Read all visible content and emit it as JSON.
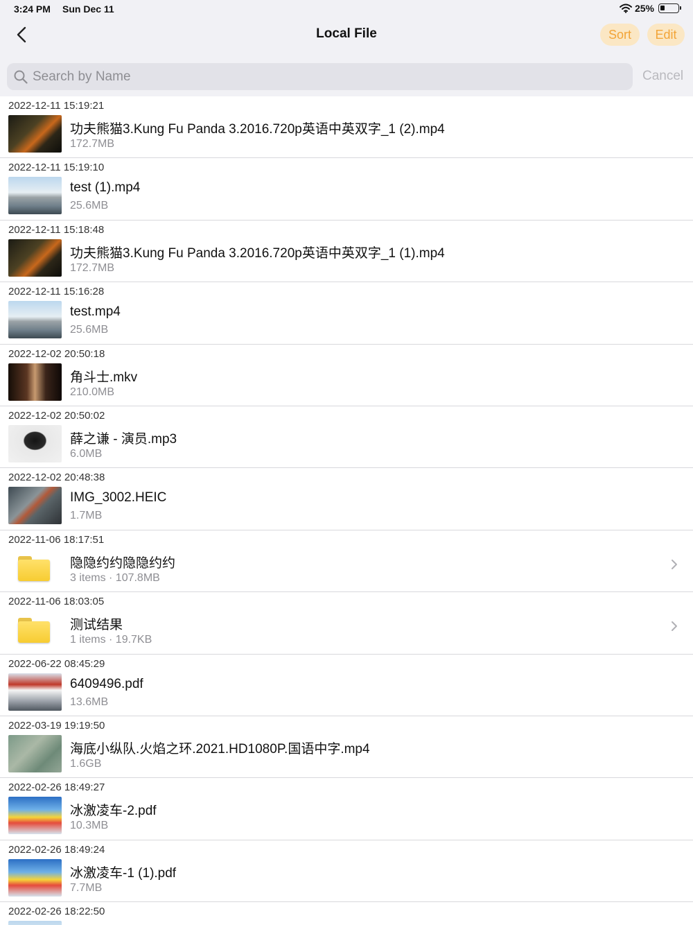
{
  "status": {
    "time": "3:24 PM",
    "date": "Sun Dec 11",
    "battery": "25%",
    "battery_level": 0.25
  },
  "nav": {
    "title": "Local File",
    "sort_label": "Sort",
    "edit_label": "Edit"
  },
  "search": {
    "placeholder": "Search by Name",
    "cancel_label": "Cancel"
  },
  "colors": {
    "accent": "#f2a437",
    "accent_bg": "#fbe7c4",
    "header_bg": "#f1f1f5"
  },
  "items": [
    {
      "timestamp": "2022-12-11 15:19:21",
      "name": "功夫熊猫3.Kung Fu Panda 3.2016.720p英语中英双字_1 (2).mp4",
      "meta": "172.7MB",
      "thumb": "th-panda"
    },
    {
      "timestamp": "2022-12-11 15:19:10",
      "name": "test (1).mp4",
      "meta": "25.6MB",
      "thumb": "th-test"
    },
    {
      "timestamp": "2022-12-11 15:18:48",
      "name": "功夫熊猫3.Kung Fu Panda 3.2016.720p英语中英双字_1 (1).mp4",
      "meta": "172.7MB",
      "thumb": "th-panda"
    },
    {
      "timestamp": "2022-12-11 15:16:28",
      "name": "test.mp4",
      "meta": "25.6MB",
      "thumb": "th-test"
    },
    {
      "timestamp": "2022-12-02 20:50:18",
      "name": "角斗士.mkv",
      "meta": "210.0MB",
      "thumb": "th-glad"
    },
    {
      "timestamp": "2022-12-02 20:50:02",
      "name": "薛之谦 - 演员.mp3",
      "meta": "6.0MB",
      "thumb": "th-mp3"
    },
    {
      "timestamp": "2022-12-02 20:48:38",
      "name": "IMG_3002.HEIC",
      "meta": "1.7MB",
      "thumb": "th-img"
    },
    {
      "timestamp": "2022-11-06 18:17:51",
      "name": "隐隐约约隐隐约约",
      "meta": "3 items · 107.8MB",
      "folder": true
    },
    {
      "timestamp": "2022-11-06 18:03:05",
      "name": "测试结果",
      "meta": "1 items · 19.7KB",
      "folder": true
    },
    {
      "timestamp": "2022-06-22 08:45:29",
      "name": "6409496.pdf",
      "meta": "13.6MB",
      "thumb": "th-pdf"
    },
    {
      "timestamp": "2022-03-19 19:19:50",
      "name": "海底小纵队.火焰之环.2021.HD1080P.国语中字.mp4",
      "meta": "1.6GB",
      "thumb": "th-hd"
    },
    {
      "timestamp": "2022-02-26 18:49:27",
      "name": "冰激凌车-2.pdf",
      "meta": "10.3MB",
      "thumb": "th-lego"
    },
    {
      "timestamp": "2022-02-26 18:49:24",
      "name": "冰激凌车-1 (1).pdf",
      "meta": "7.7MB",
      "thumb": "th-lego"
    },
    {
      "timestamp": "2022-02-26 18:22:50",
      "name": "",
      "meta": "",
      "thumb": "th-test"
    }
  ]
}
